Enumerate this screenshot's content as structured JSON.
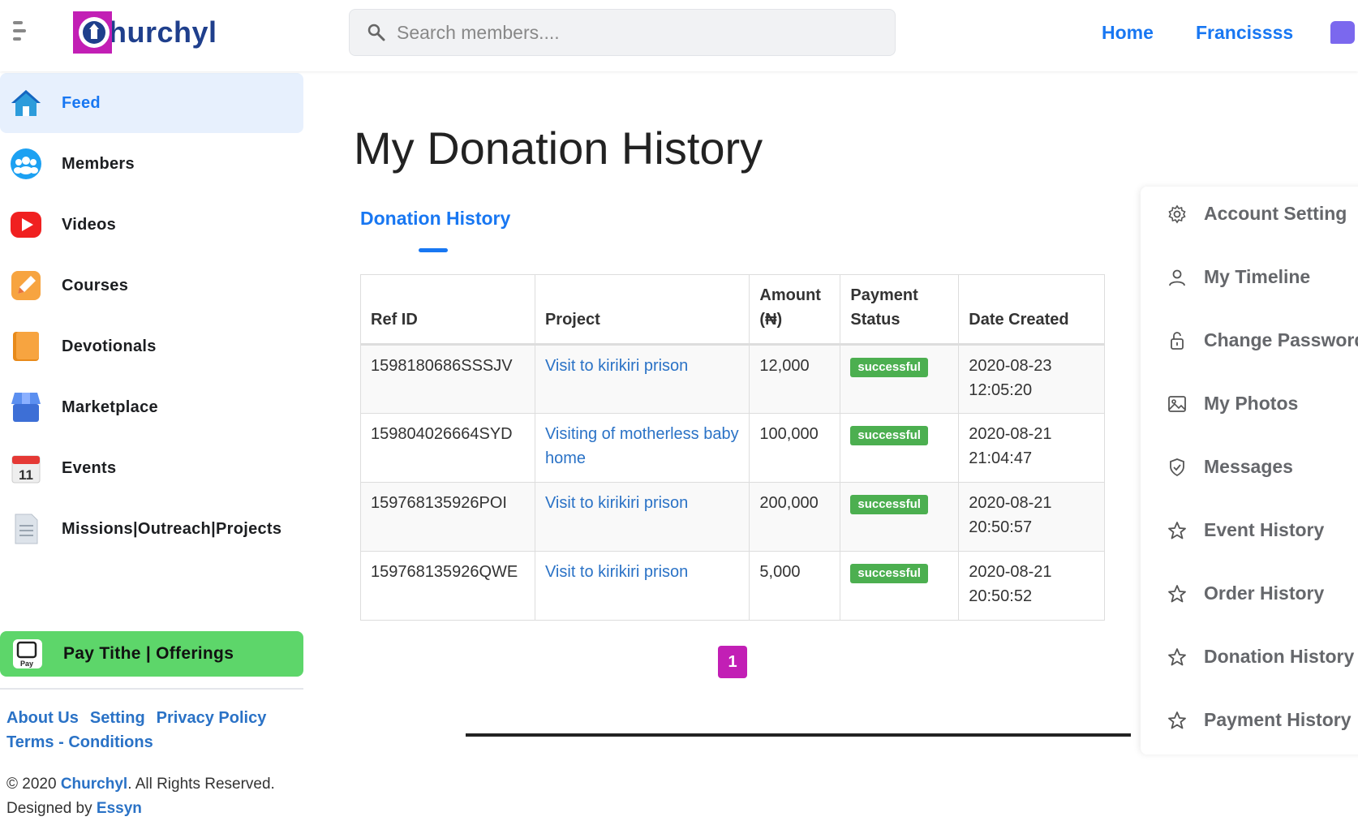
{
  "header": {
    "logo_text": "hurchyl",
    "search_placeholder": "Search members....",
    "links": [
      "Home",
      "Francissss"
    ]
  },
  "sidebar": {
    "items": [
      {
        "label": "Feed",
        "icon": "home-icon"
      },
      {
        "label": "Members",
        "icon": "members-icon"
      },
      {
        "label": "Videos",
        "icon": "video-icon"
      },
      {
        "label": "Courses",
        "icon": "courses-icon"
      },
      {
        "label": "Devotionals",
        "icon": "book-icon"
      },
      {
        "label": "Marketplace",
        "icon": "store-icon"
      },
      {
        "label": "Events",
        "icon": "calendar-icon"
      },
      {
        "label": "Missions|Outreach|Projects",
        "icon": "document-icon"
      }
    ],
    "pay_tithe": "Pay Tithe | Offerings",
    "footer_links": [
      "About Us",
      "Setting",
      "Privacy Policy",
      "Terms - Conditions"
    ],
    "copyright_prefix": "© 2020 ",
    "copyright_brand": "Churchyl",
    "copyright_suffix": ". All Rights Reserved.",
    "designed_by": "Designed by ",
    "designer": "Essyn"
  },
  "main": {
    "title": "My Donation History",
    "tab": "Donation History",
    "table": {
      "headers": [
        "Ref ID",
        "Project",
        "Amount (₦)",
        "Payment Status",
        "Date Created"
      ],
      "rows": [
        {
          "ref": "1598180686SSSJV",
          "project": "Visit to kirikiri prison",
          "amount": "12,000",
          "status": "successful",
          "date": "2020-08-23 12:05:20"
        },
        {
          "ref": "159804026664SYD",
          "project": "Visiting of motherless baby home",
          "amount": "100,000",
          "status": "successful",
          "date": "2020-08-21 21:04:47"
        },
        {
          "ref": "159768135926POI",
          "project": "Visit to kirikiri prison",
          "amount": "200,000",
          "status": "successful",
          "date": "2020-08-21 20:50:57"
        },
        {
          "ref": "159768135926QWE",
          "project": "Visit to kirikiri prison",
          "amount": "5,000",
          "status": "successful",
          "date": "2020-08-21 20:50:52"
        }
      ]
    },
    "page": "1"
  },
  "right_panel": {
    "items": [
      {
        "label": "Account Setting",
        "icon": "gear-icon"
      },
      {
        "label": "My Timeline",
        "icon": "user-icon"
      },
      {
        "label": "Change Password",
        "icon": "lock-icon"
      },
      {
        "label": "My Photos",
        "icon": "image-icon"
      },
      {
        "label": "Messages",
        "icon": "shield-icon"
      },
      {
        "label": "Event History",
        "icon": "star-icon"
      },
      {
        "label": "Order History",
        "icon": "star-icon"
      },
      {
        "label": "Donation History",
        "icon": "star-icon"
      },
      {
        "label": "Payment History",
        "icon": "star-icon"
      }
    ]
  },
  "colors": {
    "accent": "#1877f2",
    "pay_tithe_bg": "#5dd66a",
    "success_badge": "#4caf50",
    "pager_bg": "#c21fb5"
  }
}
